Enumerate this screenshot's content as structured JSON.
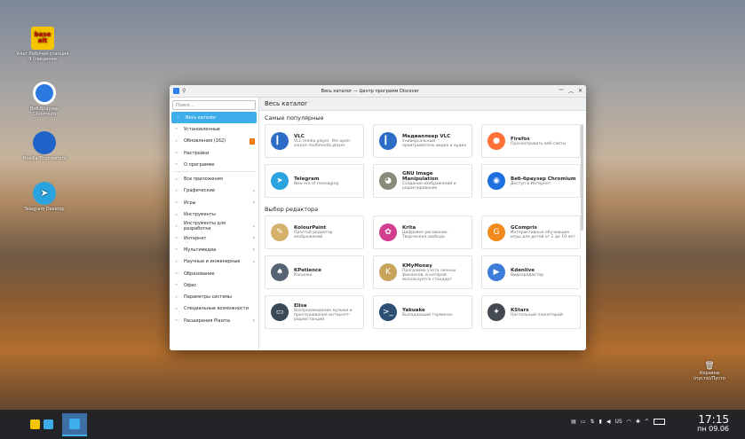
{
  "desktop": {
    "icons": [
      {
        "name": "alt-workstation",
        "logo_text": "base alt",
        "label": "Альт Рабочая станция 9 (сведения"
      },
      {
        "name": "chromium",
        "label": "Веб-браузер Chromium"
      },
      {
        "name": "thunderbird",
        "label": "Mozilla Thunderbird"
      },
      {
        "name": "telegram",
        "label": "Telegram Desktop"
      }
    ],
    "trash_label": "Корзина (пуста)/Пусто"
  },
  "window": {
    "title": "Весь каталог — Центр программ Discover",
    "controls": {
      "minimize": "﹀",
      "maximize": "︿",
      "close": "✕"
    }
  },
  "sidebar": {
    "search_placeholder": "Поиск…",
    "items": [
      {
        "label": "Весь каталог",
        "icon": "home-icon",
        "active": true
      },
      {
        "label": "Установленные",
        "icon": "installed-icon"
      },
      {
        "label": "Обновления (162)",
        "icon": "updates-icon",
        "badge": "!"
      },
      {
        "label": "Настройки",
        "icon": "settings-icon"
      },
      {
        "label": "О программе",
        "icon": "about-icon"
      },
      {
        "label": "Все приложения",
        "icon": "all-apps-icon"
      },
      {
        "label": "Графические",
        "icon": "graphics-icon",
        "chevron": true
      },
      {
        "label": "Игры",
        "icon": "games-icon",
        "chevron": true
      },
      {
        "label": "Инструменты",
        "icon": "tools-icon"
      },
      {
        "label": "Инструменты для разработки",
        "icon": "dev-tools-icon",
        "chevron": true
      },
      {
        "label": "Интернет",
        "icon": "internet-icon",
        "chevron": true
      },
      {
        "label": "Мультимедиа",
        "icon": "multimedia-icon",
        "chevron": true
      },
      {
        "label": "Научные и инженерные",
        "icon": "science-icon",
        "chevron": true
      },
      {
        "label": "Образование",
        "icon": "education-icon"
      },
      {
        "label": "Офис",
        "icon": "office-icon"
      },
      {
        "label": "Параметры системы",
        "icon": "system-settings-icon"
      },
      {
        "label": "Специальные возможности",
        "icon": "accessibility-icon"
      },
      {
        "label": "Расширения Plasma",
        "icon": "plasma-extensions-icon",
        "chevron": true
      }
    ]
  },
  "main": {
    "header": "Весь каталог",
    "sections": [
      {
        "title": "Самые популярные",
        "apps": [
          {
            "name": "VLC",
            "desc": "VLC media player, the open-source multimedia player",
            "color": "#2b6cc4",
            "glyph": "▎"
          },
          {
            "name": "Медиаплеер VLC",
            "desc": "Универсальный проигрыватель видео и аудио",
            "color": "#2b6cc4",
            "glyph": "▎"
          },
          {
            "name": "Firefox",
            "desc": "Просматривать веб-сайты",
            "color": "#ff7139",
            "glyph": "●"
          },
          {
            "name": "Telegram",
            "desc": "New era of messaging",
            "color": "#2aa3df",
            "glyph": "➤"
          },
          {
            "name": "GNU Image Manipulation",
            "desc": "Создание изображений и редактирование",
            "color": "#8a8a7a",
            "glyph": "◕"
          },
          {
            "name": "Веб-браузер Chromium",
            "desc": "Доступ в Интернет",
            "color": "#1e6fe0",
            "glyph": "◉"
          }
        ]
      },
      {
        "title": "Выбор редактора",
        "apps": [
          {
            "name": "KolourPaint",
            "desc": "Простой редактор изображений",
            "color": "#d4b06a",
            "glyph": "✎"
          },
          {
            "name": "Krita",
            "desc": "Цифровое рисование. Творческая свобода",
            "color": "#d23f8e",
            "glyph": "✿"
          },
          {
            "name": "GCompris",
            "desc": "Интерактивные обучающие игры для детей от 2 до 10 лет",
            "color": "#f08a1c",
            "glyph": "G"
          },
          {
            "name": "KPatience",
            "desc": "Косынка",
            "color": "#566473",
            "glyph": "♠"
          },
          {
            "name": "KMyMoney",
            "desc": "Программа учета личных финансов, в которой используется стандарт",
            "color": "#c7a45a",
            "glyph": "K"
          },
          {
            "name": "Kdenlive",
            "desc": "Видеоредактор",
            "color": "#3b7dd8",
            "glyph": "▶"
          },
          {
            "name": "Elisa",
            "desc": "Воспроизведение музыки и прослушивание интернет-радиостанций",
            "color": "#3a4a56",
            "glyph": "▭"
          },
          {
            "name": "Yakuake",
            "desc": "Выпадающий терминал",
            "color": "#2d4f73",
            "glyph": ">_"
          },
          {
            "name": "KStars",
            "desc": "Настольный планетарий",
            "color": "#444a52",
            "glyph": "✦"
          }
        ]
      }
    ]
  },
  "taskbar": {
    "tray_items": [
      "clipboard-icon",
      "display-icon",
      "network-icon",
      "battery-icon",
      "volume-icon",
      "US",
      "wifi-icon",
      "bluetooth-icon",
      "arrow-up-icon",
      "notifications-icon"
    ],
    "keyboard_layout": "US",
    "time": "17:15",
    "date": "пн 09.06"
  }
}
